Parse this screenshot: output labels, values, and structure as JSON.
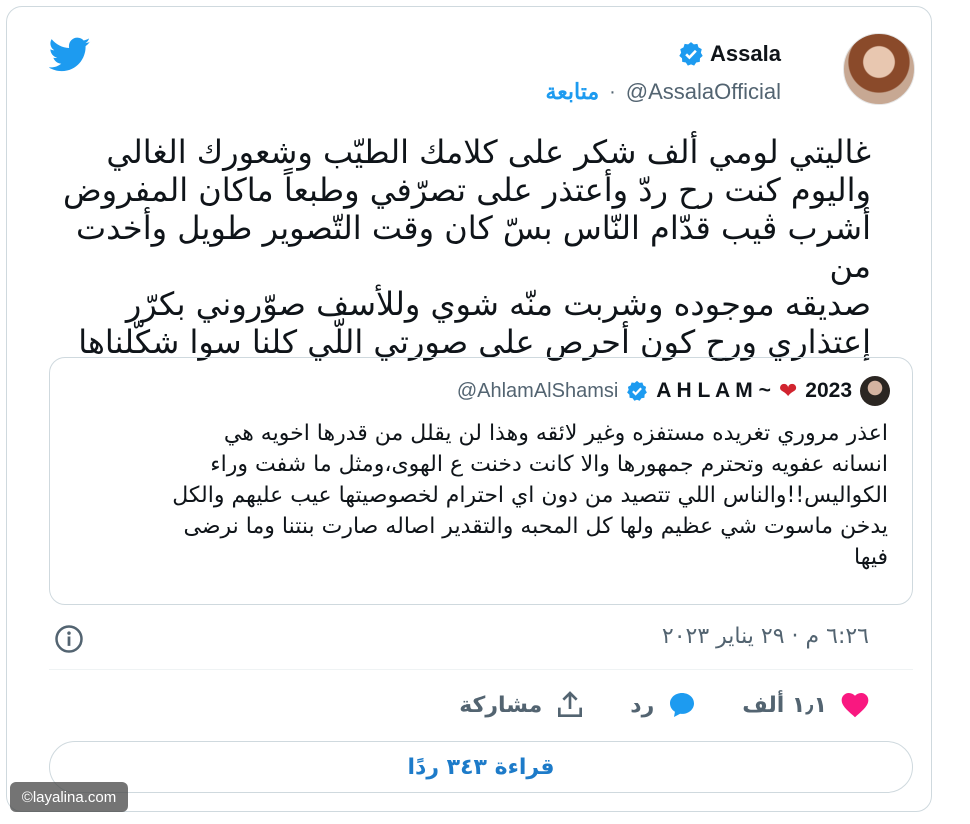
{
  "author": {
    "display_name": "Assala",
    "handle": "@AssalaOfficial",
    "separator": "·",
    "follow_label": "متابعة"
  },
  "tweet": {
    "lines": [
      "غاليتي لومي ألف شكر على كلامك الطيّب وشعورك الغالي",
      "واليوم كنت رح ردّ وأعتذر على تصرّفي وطبعاً ماكان المفروض",
      "أشرب ڤيب قدّام النّاس بسّ كان وقت التّصوير طويل وأخدت من",
      "صديقه موجوده وشربت منّه شوي وللأسف صوّروني بكرّر",
      "إعتذاري ورح كون أحرص على صورتي اللّي كلنا سوا شكّلناها"
    ]
  },
  "quoted_tweet": {
    "name": "A H L A M ~",
    "heart": "❤",
    "year": "2023",
    "handle": "@AhlamAlShamsi",
    "lines": [
      "اعذر مروري تغريده مستفزه وغير لائقه وهذا لن يقلل من قدرها اخويه هي",
      "انسانه عفويه وتحترم جمهورها والا كانت دخنت ع الهوى،ومثل ما شفت وراء",
      "الكواليس!!والناس اللي تتصيد من دون اي احترام لخصوصيتها عيب عليهم والكل",
      "يدخن ماسوت شي عظيم ولها كل المحبه والتقدير اصاله صارت بنتنا وما نرضى",
      "فيها"
    ]
  },
  "meta": {
    "timestamp": "٦:٢٦ م · ٢٩ يناير ٢٠٢٣"
  },
  "actions": {
    "like_count": "١٫١ ألف",
    "reply_label": "رد",
    "share_label": "مشاركة"
  },
  "read_replies_label": "قراءة ٣٤٣ ردًا",
  "watermark": "©layalina.com",
  "colors": {
    "twitter_blue": "#1d9bf0",
    "like_pink": "#f91880",
    "verified_blue": "#1d9bf0"
  }
}
